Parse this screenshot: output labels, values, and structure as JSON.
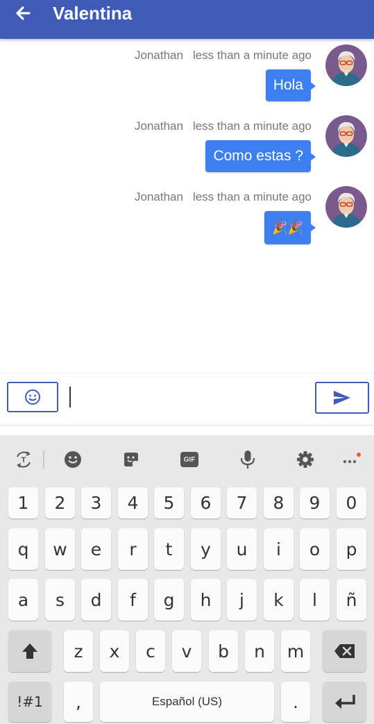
{
  "header": {
    "title": "Valentina",
    "background": "#3f5bb7"
  },
  "messages": [
    {
      "sender": "Jonathan",
      "time": "less than a minute ago",
      "text": "Hola"
    },
    {
      "sender": "Jonathan",
      "time": "less than a minute ago",
      "text": "Como estas ?"
    },
    {
      "sender": "Jonathan",
      "time": "less than a minute ago",
      "text": "🎉🎉"
    }
  ],
  "composer": {
    "value": "",
    "placeholder": ""
  },
  "keyboard": {
    "toolbar": [
      "translate-icon",
      "emoji-icon",
      "sticker-icon",
      "gif-icon",
      "microphone-icon",
      "settings-icon",
      "more-icon"
    ],
    "gif_label": "GIF",
    "row_numbers": [
      "1",
      "2",
      "3",
      "4",
      "5",
      "6",
      "7",
      "8",
      "9",
      "0"
    ],
    "row1": [
      "q",
      "w",
      "e",
      "r",
      "t",
      "y",
      "u",
      "i",
      "o",
      "p"
    ],
    "row2": [
      "a",
      "s",
      "d",
      "f",
      "g",
      "h",
      "j",
      "k",
      "l",
      "ñ"
    ],
    "row3": [
      "z",
      "x",
      "c",
      "v",
      "b",
      "n",
      "m"
    ],
    "symbols_label": "!#1",
    "comma": ",",
    "space_label": "Español (US)",
    "period": "."
  },
  "colors": {
    "bubble": "#3b7ff1",
    "accent": "#3f5bb7",
    "notification_dot": "#ff5722"
  }
}
